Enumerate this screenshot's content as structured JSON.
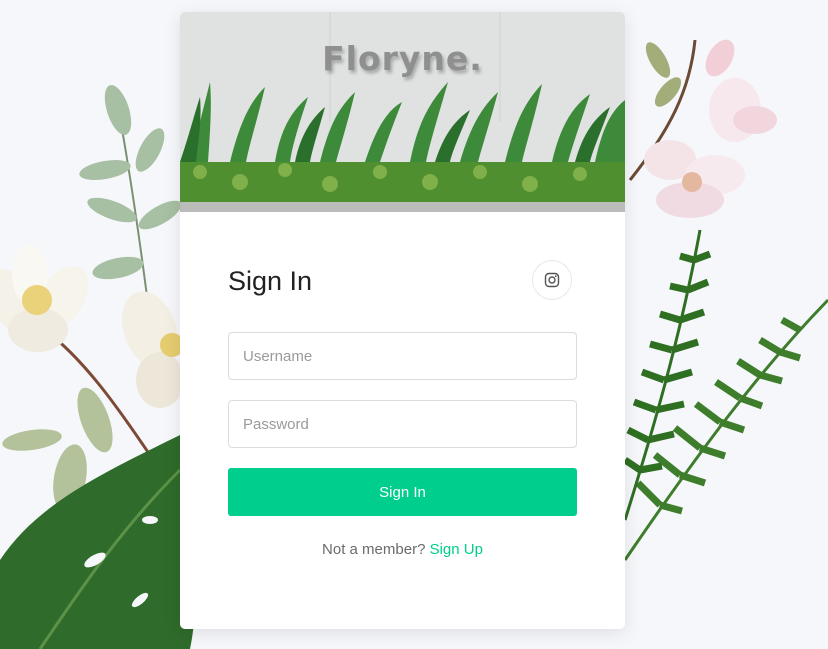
{
  "brand": {
    "name": "Floryne."
  },
  "signin": {
    "heading": "Sign In",
    "social_icon": "instagram-icon",
    "username": {
      "value": "",
      "placeholder": "Username"
    },
    "password": {
      "value": "",
      "placeholder": "Password"
    },
    "submit_label": "Sign In",
    "footer_prompt": "Not a member?",
    "footer_link": "Sign Up"
  },
  "colors": {
    "accent": "#00ce8c",
    "page_background": "#f6f7fb",
    "card_background": "#ffffff",
    "brand_text": "#8f8f8f"
  }
}
